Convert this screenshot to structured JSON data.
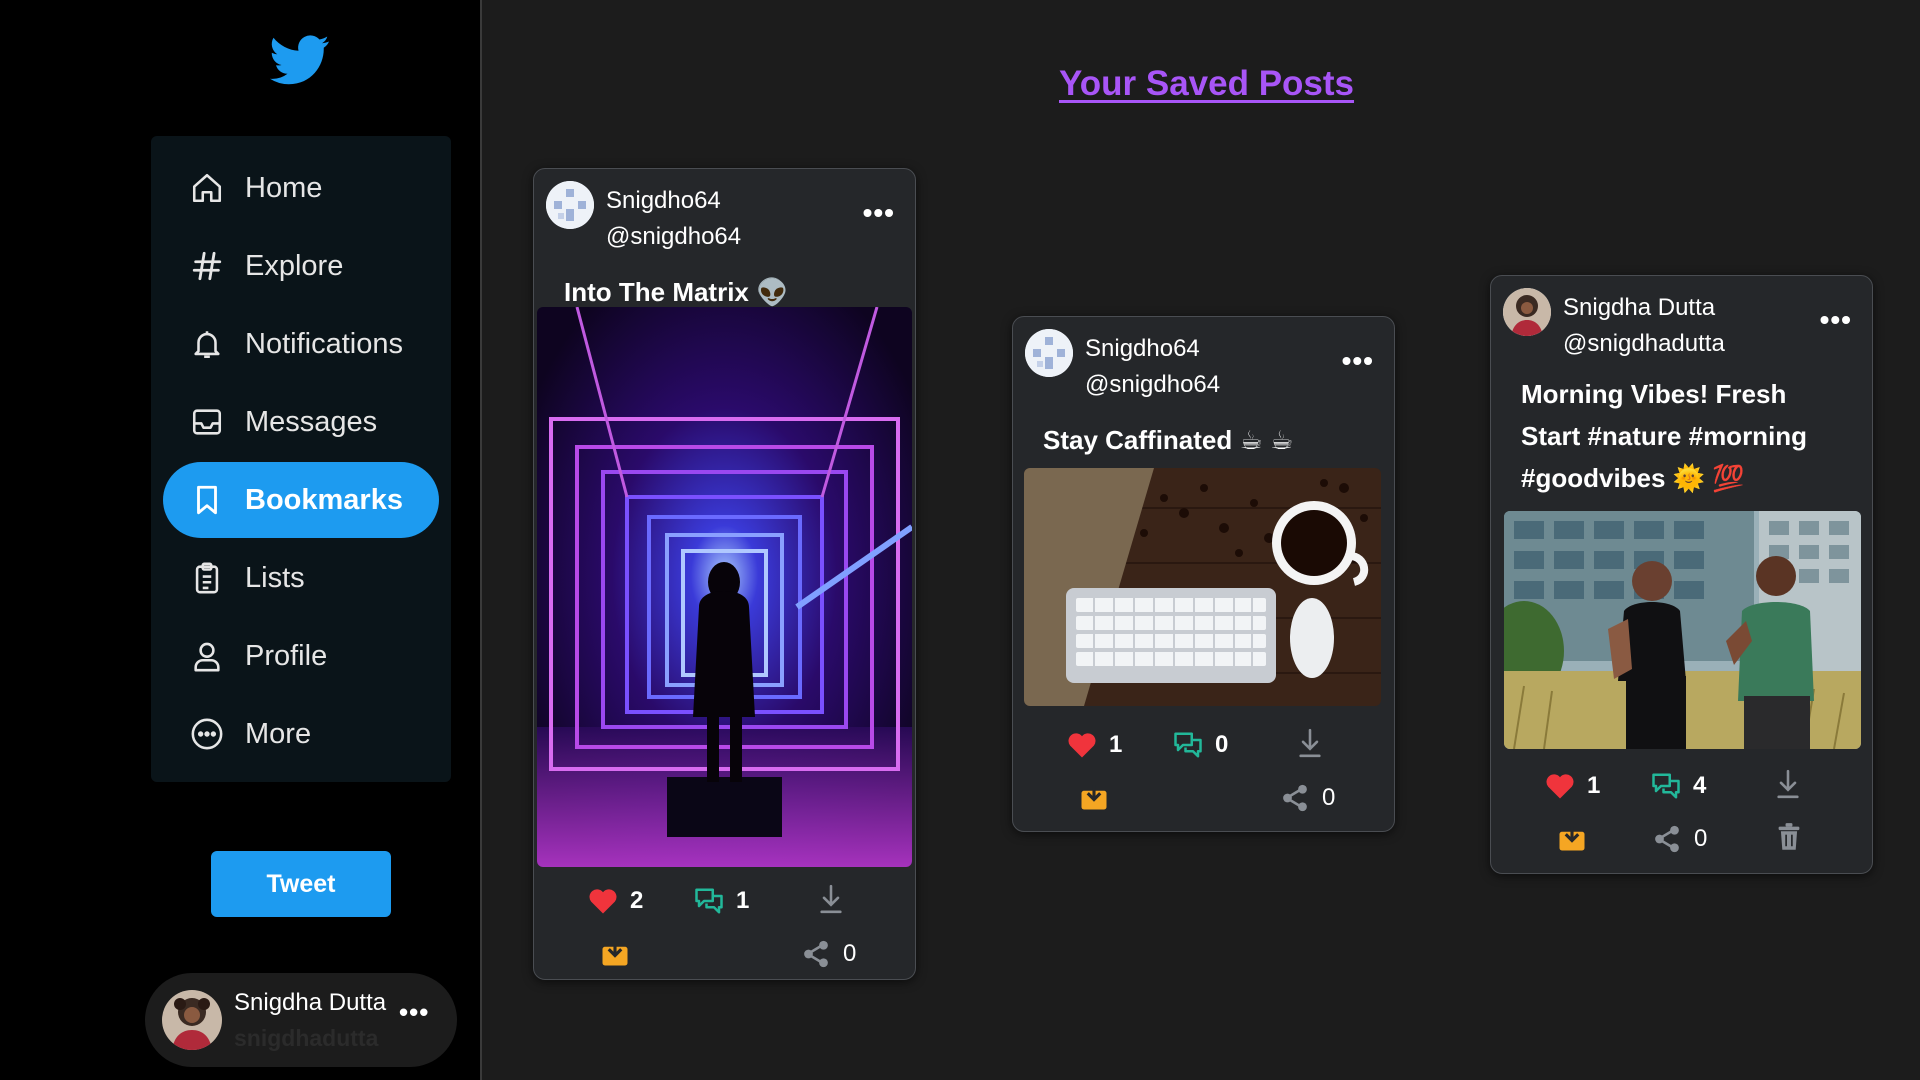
{
  "app": {
    "brand_color": "#1d9bf0",
    "accent_title": "#a855f7"
  },
  "sidebar": {
    "logo": "twitter-bird-icon",
    "items": [
      {
        "label": "Home",
        "icon": "home-icon"
      },
      {
        "label": "Explore",
        "icon": "hashtag-icon"
      },
      {
        "label": "Notifications",
        "icon": "bell-icon"
      },
      {
        "label": "Messages",
        "icon": "inbox-icon"
      },
      {
        "label": "Bookmarks",
        "icon": "bookmark-icon",
        "active": true
      },
      {
        "label": "Lists",
        "icon": "clipboard-list-icon"
      },
      {
        "label": "Profile",
        "icon": "user-icon"
      },
      {
        "label": "More",
        "icon": "more-circle-icon"
      }
    ],
    "tweet_button": "Tweet",
    "user": {
      "name": "Snigdha Dutta",
      "handle": "snigdhadutta",
      "menu": "•••"
    }
  },
  "main": {
    "title": "Your Saved Posts",
    "posts": [
      {
        "name": "Snigdho64",
        "handle": "@snigdho64",
        "menu": "•••",
        "text": "Into The Matrix 👽",
        "image": "neon tunnel with silhouette",
        "likes": "2",
        "comments": "1",
        "shares": "0"
      },
      {
        "name": "Snigdho64",
        "handle": "@snigdho64",
        "menu": "•••",
        "text": "Stay Caffinated ☕ ☕",
        "image": "keyboard, mouse and coffee cup",
        "likes": "1",
        "comments": "0",
        "shares": "0"
      },
      {
        "name": "Snigdha Dutta",
        "handle": "@snigdhadutta",
        "menu": "•••",
        "text": "Morning Vibes! Fresh Start #nature #morning #goodvibes 🌞 💯",
        "image": "two people jogging",
        "likes": "1",
        "comments": "4",
        "shares": "0"
      }
    ]
  }
}
